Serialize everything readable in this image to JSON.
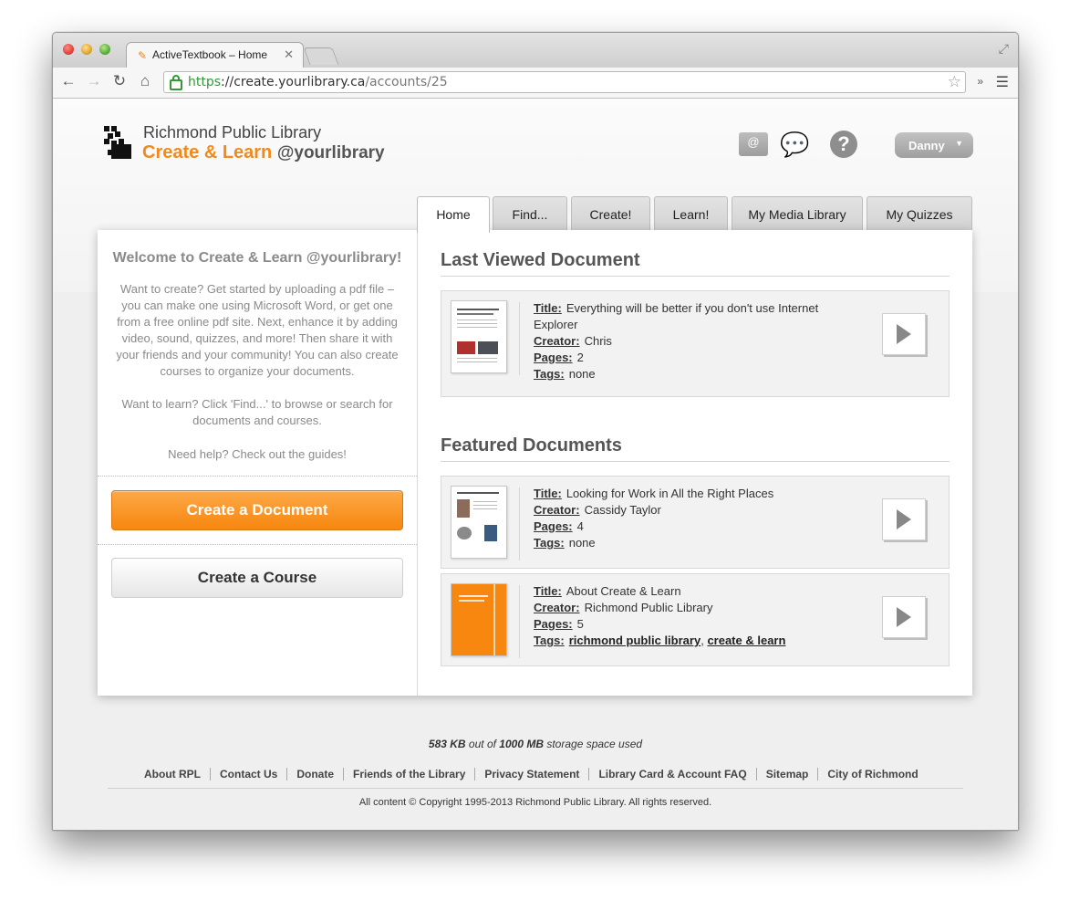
{
  "browser": {
    "tab_title": "ActiveTextbook – Home",
    "url_scheme": "https",
    "url_host": "://create.yourlibrary.ca",
    "url_path": "/accounts/25"
  },
  "header": {
    "brand_line1": "Richmond Public Library",
    "brand_orange": "Create & Learn",
    "brand_handle": "@yourlibrary",
    "user_name": "Danny"
  },
  "nav_tabs": [
    "Home",
    "Find...",
    "Create!",
    "Learn!",
    "My Media Library",
    "My Quizzes"
  ],
  "left": {
    "welcome_title": "Welcome to Create & Learn @yourlibrary!",
    "para1_lines": [
      "Want to create? Get started by uploading a pdf file –",
      "you can make one using Microsoft Word, or get one",
      "from a free online pdf site. Next, enhance it by adding",
      "video, sound, quizzes, and more! Then share it with",
      "your friends and your community! You can also create",
      "courses to organize your documents."
    ],
    "para2_lines": [
      "Want to learn? Click 'Find...' to browse or search for",
      "documents and courses."
    ],
    "para3": "Need help? Check out the guides!",
    "create_doc_label": "Create a Document",
    "create_course_label": "Create a Course"
  },
  "labels": {
    "title": "Title:",
    "creator": "Creator:",
    "pages": "Pages:",
    "tags": "Tags:"
  },
  "last_viewed": {
    "heading": "Last Viewed Document",
    "doc": {
      "title_line1": "Everything will be better if you don't use Internet",
      "title_line2": "Explorer",
      "creator": "Chris",
      "pages": "2",
      "tags": "none"
    }
  },
  "featured": {
    "heading": "Featured Documents",
    "docs": [
      {
        "title": "Looking for Work in All the Right Places",
        "creator": "Cassidy Taylor",
        "pages": "4",
        "tags": "none"
      },
      {
        "title": "About Create & Learn",
        "creator": "Richmond Public Library",
        "pages": "5",
        "tag1": "richmond public library",
        "tag_sep": ",",
        "tag2": "create & learn"
      }
    ]
  },
  "footer": {
    "storage_used": "583 KB",
    "storage_mid": "out of",
    "storage_total": "1000 MB",
    "storage_tail": "storage space used",
    "links": [
      "About RPL",
      "Contact Us",
      "Donate",
      "Friends of the Library",
      "Privacy Statement",
      "Library Card & Account FAQ",
      "Sitemap",
      "City of Richmond"
    ],
    "copyright": "All content © Copyright 1995-2013 Richmond Public Library. All rights reserved."
  },
  "colors": {
    "brand_orange": "#f08a1c",
    "button_orange": "#f7870f",
    "secure_green": "#2e9b35"
  }
}
